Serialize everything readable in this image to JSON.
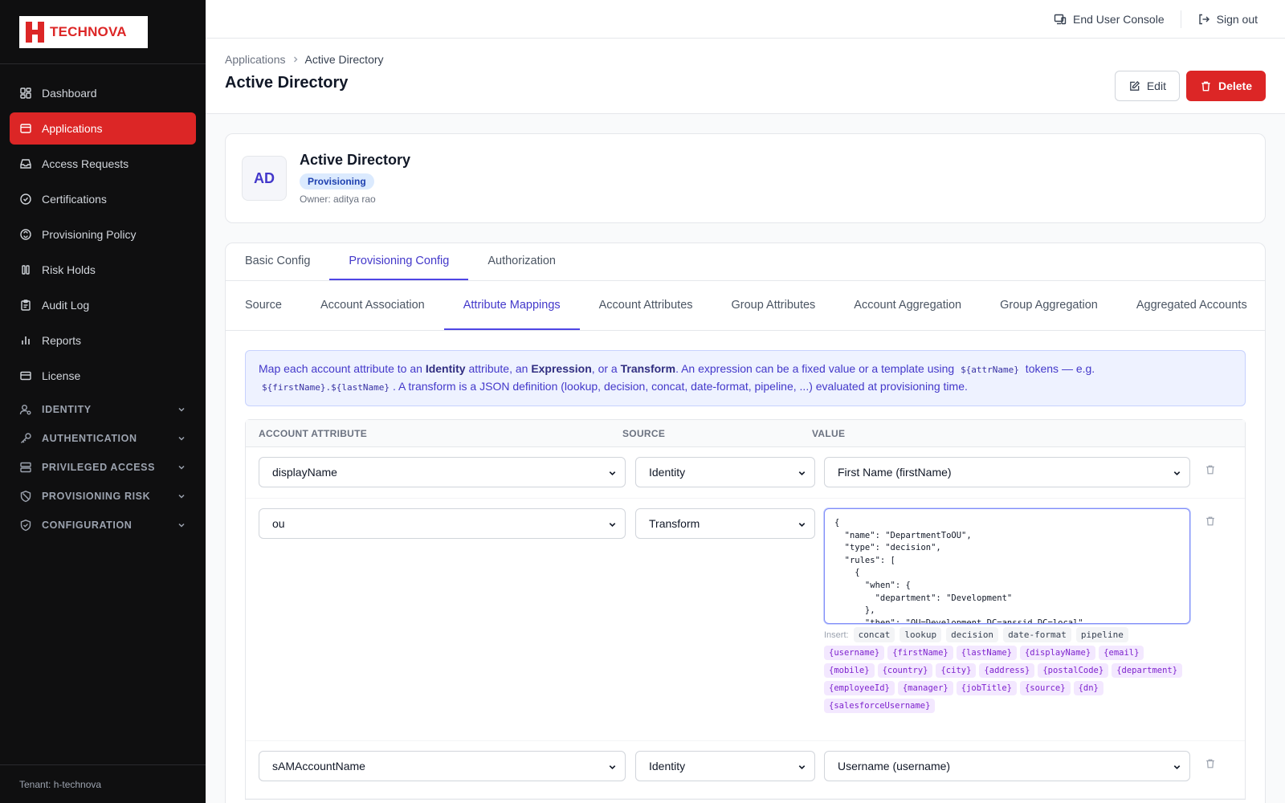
{
  "brand": {
    "name": "TECHNOVA"
  },
  "sidebar": {
    "items": [
      {
        "label": "Dashboard",
        "icon": "dashboard-icon"
      },
      {
        "label": "Applications",
        "icon": "applications-icon",
        "active": true
      },
      {
        "label": "Access Requests",
        "icon": "inbox-icon"
      },
      {
        "label": "Certifications",
        "icon": "check-circle-icon"
      },
      {
        "label": "Provisioning Policy",
        "icon": "policy-icon"
      },
      {
        "label": "Risk Holds",
        "icon": "pause-icon"
      },
      {
        "label": "Audit Log",
        "icon": "clipboard-icon"
      },
      {
        "label": "Reports",
        "icon": "bar-chart-icon"
      },
      {
        "label": "License",
        "icon": "card-icon"
      }
    ],
    "sections": [
      {
        "label": "IDENTITY",
        "icon": "user-gear-icon"
      },
      {
        "label": "AUTHENTICATION",
        "icon": "key-icon"
      },
      {
        "label": "PRIVILEGED ACCESS",
        "icon": "server-icon"
      },
      {
        "label": "PROVISIONING RISK",
        "icon": "ban-icon"
      },
      {
        "label": "CONFIGURATION",
        "icon": "shield-check-icon"
      }
    ],
    "tenant": "Tenant: h-technova"
  },
  "topbar": {
    "console_label": "End User Console",
    "signout_label": "Sign out"
  },
  "header": {
    "breadcrumb_root": "Applications",
    "breadcrumb_current": "Active Directory",
    "title": "Active Directory",
    "edit_label": "Edit",
    "delete_label": "Delete"
  },
  "app": {
    "initials": "AD",
    "name": "Active Directory",
    "badge": "Provisioning",
    "owner": "Owner: aditya rao"
  },
  "tabs": {
    "main": [
      "Basic Config",
      "Provisioning Config",
      "Authorization"
    ],
    "main_active": 1,
    "sub": [
      "Source",
      "Account Association",
      "Attribute Mappings",
      "Account Attributes",
      "Group Attributes",
      "Account Aggregation",
      "Group Aggregation",
      "Aggregated Accounts"
    ],
    "sub_active": 2
  },
  "info": {
    "t1": "Map each account attribute to an ",
    "b1": "Identity",
    "t2": " attribute, an ",
    "b2": "Expression",
    "t3": ", or a ",
    "b3": "Transform",
    "t4": ". An expression can be a fixed value or a template using ",
    "c1": "${attrName}",
    "t5": " tokens — e.g. ",
    "c2": "${firstName}.${lastName}",
    "t6": ". A transform is a JSON definition (lookup, decision, concat, date-format, pipeline, ...) evaluated at provisioning time."
  },
  "table": {
    "headers": [
      "ACCOUNT ATTRIBUTE",
      "SOURCE",
      "VALUE"
    ],
    "rows": [
      {
        "attribute": "displayName",
        "source": "Identity",
        "value": "First Name (firstName)"
      },
      {
        "attribute": "ou",
        "source": "Transform",
        "value": "{\n  \"name\": \"DepartmentToOU\",\n  \"type\": \"decision\",\n  \"rules\": [\n    {\n      \"when\": {\n        \"department\": \"Development\"\n      },\n      \"then\": \"OU=Development,DC=anssid,DC=local\""
      },
      {
        "attribute": "sAMAccountName",
        "source": "Identity",
        "value": "Username (username)"
      }
    ]
  },
  "insert": {
    "label": "Insert:",
    "ops": [
      "concat",
      "lookup",
      "decision",
      "date-format",
      "pipeline"
    ],
    "tokens": [
      "{username}",
      "{firstName}",
      "{lastName}",
      "{displayName}",
      "{email}",
      "{mobile}",
      "{country}",
      "{city}",
      "{address}",
      "{postalCode}",
      "{department}",
      "{employeeId}",
      "{manager}",
      "{jobTitle}",
      "{source}",
      "{dn}",
      "{salesforceUsername}"
    ]
  },
  "colors": {
    "accent": "#dc2626",
    "primary": "#4f46e5",
    "sidebar_bg": "#0f0f10"
  }
}
